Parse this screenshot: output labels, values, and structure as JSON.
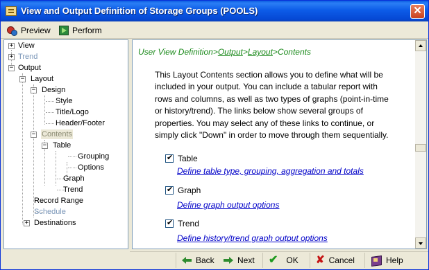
{
  "window": {
    "title": "View and Output Definition of Storage Groups (POOLS)",
    "close_glyph": "✕"
  },
  "toolbar": {
    "preview_label": "Preview",
    "perform_label": "Perform"
  },
  "tree": {
    "expanders": {
      "view": "+",
      "trend": "+",
      "output": "−",
      "layout": "−",
      "design": "−",
      "contents": "−",
      "table": "−",
      "destinations": "+"
    },
    "items": {
      "view": "View",
      "trend": "Trend",
      "output": "Output",
      "layout": "Layout",
      "design": "Design",
      "style": "Style",
      "title_logo": "Title/Logo",
      "header_footer": "Header/Footer",
      "contents": "Contents",
      "table": "Table",
      "grouping": "Grouping",
      "options": "Options",
      "graph": "Graph",
      "trend_sub": "Trend",
      "record_range": "Record Range",
      "schedule": "Schedule",
      "destinations": "Destinations"
    }
  },
  "content": {
    "breadcrumb": {
      "part1": "User View Definition>",
      "output": "Output",
      "sep1": ">",
      "layout": "Layout",
      "sep2": ">",
      "current": "Contents"
    },
    "intro_lines": [
      "This Layout Contents section allows you to define what will be",
      "included in your output.  You can include a tabular report with",
      "rows and columns, as well as two types of graphs (point-in-time",
      "or history/trend). The links below show several groups of",
      "properties. You may select any of these links to continue, or",
      "simply click \"Down\" in order to move through them sequentially."
    ],
    "options": {
      "table_label": "Table",
      "table_link": " Define table type, grouping, aggregation and totals",
      "graph_label": "Graph",
      "graph_link": "Define graph output options",
      "trend_label": "Trend",
      "trend_link": "Define history/trend graph output options"
    }
  },
  "buttons": {
    "back": "Back",
    "next": "Next",
    "ok": "OK",
    "cancel": "Cancel",
    "help": "Help",
    "ok_glyph": "✔",
    "cancel_glyph": "✘"
  }
}
